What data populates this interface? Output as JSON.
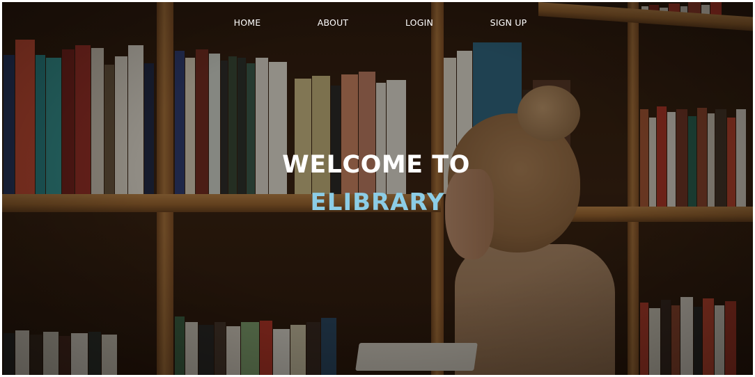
{
  "nav": {
    "items": [
      {
        "label": "HOME"
      },
      {
        "label": "ABOUT"
      },
      {
        "label": "LOGIN"
      },
      {
        "label": "SIGN UP"
      }
    ]
  },
  "hero": {
    "line1": "WELCOME TO",
    "line2": "ELIBRARY"
  },
  "colors": {
    "nav_text": "#ffffff",
    "title_white": "#ffffff",
    "accent": "#8ccde6",
    "overlay": "rgba(10,6,3,0.42)"
  },
  "background": {
    "image_subject": "woman-reading-in-library-bookshelves"
  }
}
